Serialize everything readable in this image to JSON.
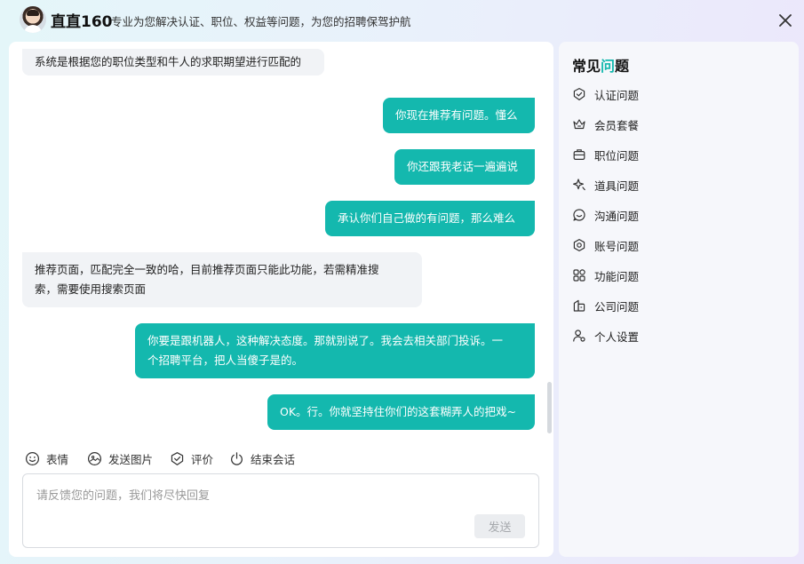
{
  "header": {
    "brand": "直直160",
    "slogan": "专业为您解决认证、职位、权益等问题，为您的招聘保驾护航"
  },
  "messages": [
    {
      "role": "bot",
      "lines": [
        "系统是根据您的职位类型和牛人的求职期望进行匹配的"
      ]
    },
    {
      "role": "user",
      "lines": [
        "你现在推荐有问题。懂么"
      ]
    },
    {
      "role": "user",
      "lines": [
        "你还跟我老话一遍遍说"
      ]
    },
    {
      "role": "user",
      "lines": [
        "承认你们自己做的有问题，那么难么"
      ]
    },
    {
      "role": "bot",
      "lines": [
        "推荐页面，匹配完全一致的哈，目前推荐页面只能此功能，若需精准搜",
        "索，需要使用搜索页面"
      ]
    },
    {
      "role": "user",
      "lines": [
        "你要是跟机器人，这种解决态度。那就别说了。我会去相关部门投诉。一",
        "个招聘平台，把人当傻子是的。"
      ]
    },
    {
      "role": "user",
      "lines": [
        "OK。行。你就坚持住你们的这套糊弄人的把戏~"
      ]
    }
  ],
  "toolbar": {
    "emoji": "表情",
    "image": "发送图片",
    "rate": "评价",
    "end": "结束会话"
  },
  "input": {
    "placeholder": "请反馈您的问题，我们将尽快回复",
    "value": "",
    "send_label": "发送"
  },
  "faq": {
    "title_pre": "常见",
    "title_accent": "问",
    "title_post": "题",
    "items": [
      {
        "label": "认证问题",
        "icon": "shield-check-icon"
      },
      {
        "label": "会员套餐",
        "icon": "crown-icon"
      },
      {
        "label": "职位问题",
        "icon": "briefcase-icon"
      },
      {
        "label": "道具问题",
        "icon": "sparkle-icon"
      },
      {
        "label": "沟通问题",
        "icon": "chat-smile-icon"
      },
      {
        "label": "账号问题",
        "icon": "hexagon-icon"
      },
      {
        "label": "功能问题",
        "icon": "grid-icon"
      },
      {
        "label": "公司问题",
        "icon": "building-icon"
      },
      {
        "label": "个人设置",
        "icon": "user-gear-icon"
      }
    ]
  },
  "colors": {
    "accent": "#14b8ae",
    "bot_bubble": "#f1f3f6"
  }
}
